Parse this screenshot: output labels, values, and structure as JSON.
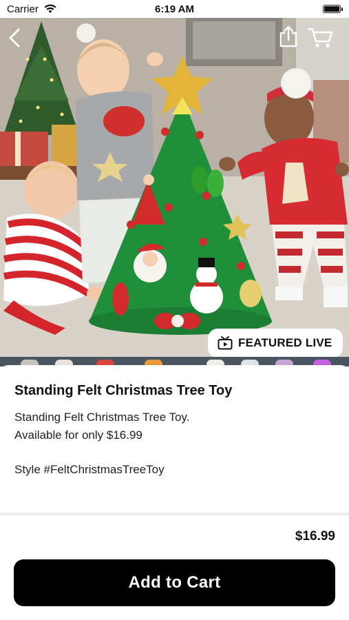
{
  "status_bar": {
    "carrier": "Carrier",
    "time": "6:19 AM"
  },
  "nav": {
    "back_icon": "chevron-left-icon",
    "share_icon": "share-icon",
    "cart_icon": "cart-icon"
  },
  "hero": {
    "image_subject": "toddlers decorating a felt christmas tree toy",
    "badge_label": "FEATURED LIVE",
    "badge_icon": "tv-icon"
  },
  "product": {
    "title": "Standing Felt Christmas Tree Toy",
    "description_line1": "Standing Felt Christmas Tree Toy.",
    "description_line2": "Available for only $16.99",
    "style_tag": "Style #FeltChristmasTreeToy",
    "price": "$16.99"
  },
  "actions": {
    "add_to_cart_label": "Add to Cart"
  },
  "colors": {
    "button_bg": "#000000",
    "button_text": "#ffffff"
  }
}
